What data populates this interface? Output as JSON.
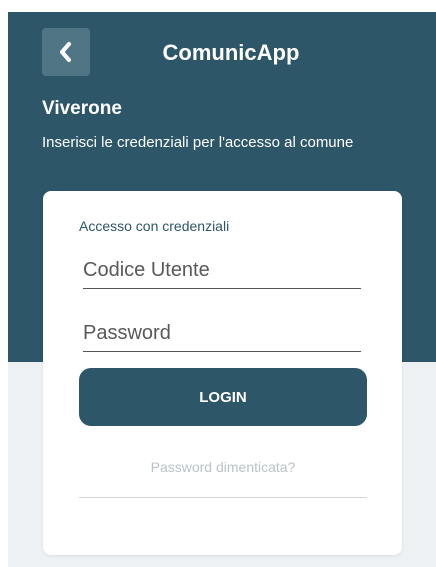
{
  "header": {
    "app_title": "ComunicApp",
    "back_icon": "chevron-left-icon"
  },
  "hero": {
    "place_name": "Viverone",
    "subtitle": "Inserisci le credenziali per l'accesso al comune"
  },
  "login_form": {
    "caption": "Accesso con credenziali",
    "user_code_placeholder": "Codice Utente",
    "password_placeholder": "Password",
    "login_label": "LOGIN",
    "forgot_password_label": "Password dimenticata?"
  },
  "colors": {
    "primary": "#2d5668",
    "back_button_bg": "#507685",
    "page_bg": "#eef1f3",
    "link_muted": "#b9c3c8"
  }
}
